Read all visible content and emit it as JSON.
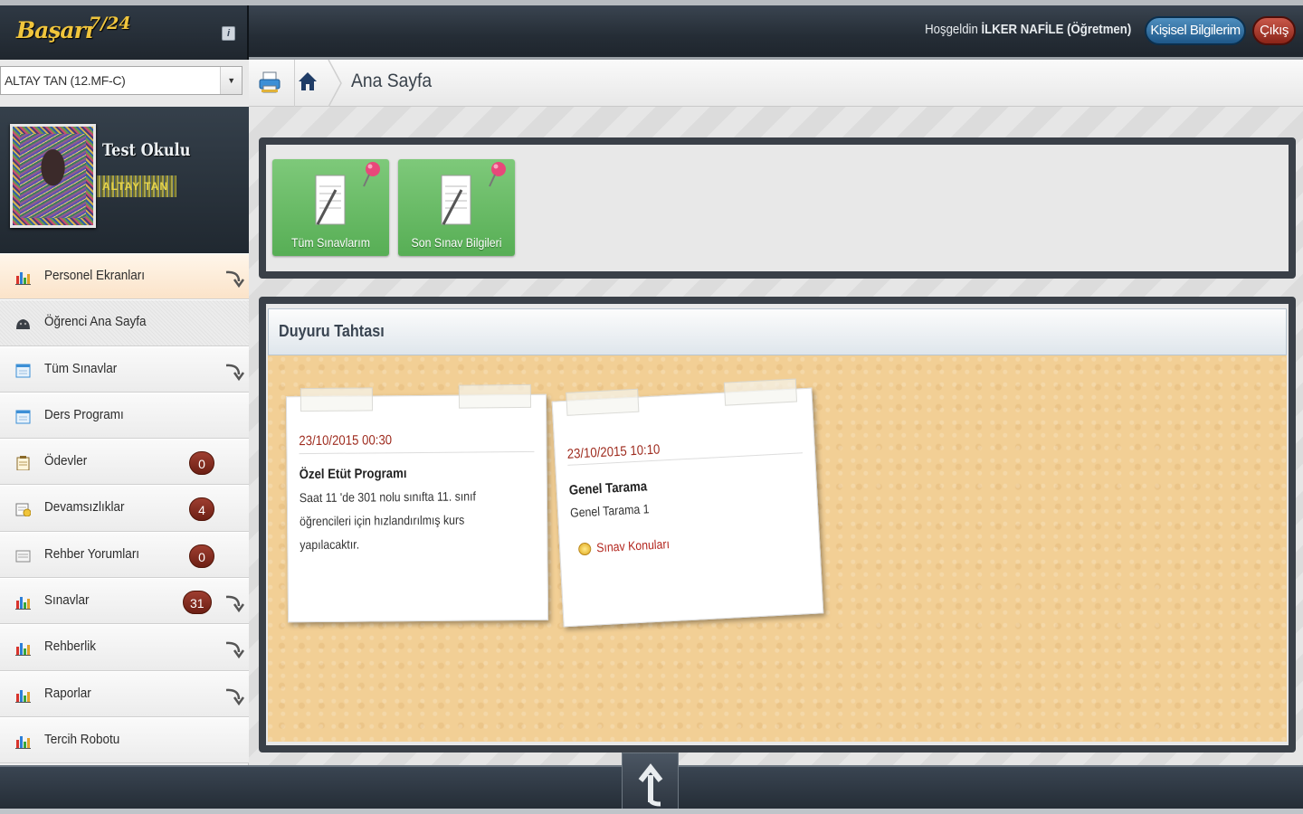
{
  "header": {
    "logo_text": "Başarı",
    "logo_sup": "7/24",
    "info_icon": "i",
    "welcome_prefix": "Hoşgeldin",
    "welcome_user": "İLKER NAFİLE (Öğretmen)",
    "profile_button": "Kişisel Bilgilerim",
    "exit_button": "Çıkış"
  },
  "student_select": {
    "value": "ALTAY TAN (12.MF-C)"
  },
  "breadcrumb": {
    "title": "Ana Sayfa"
  },
  "profile": {
    "school": "Test Okulu",
    "student_name": "ALTAY TAN"
  },
  "sidebar": {
    "items": [
      {
        "label": "Personel Ekranları",
        "icon": "bar-chart-icon",
        "arrow": true
      },
      {
        "label": "Öğrenci Ana Sayfa",
        "icon": "student-icon",
        "arrow": false
      },
      {
        "label": "Tüm Sınavlar",
        "icon": "calendar-icon",
        "arrow": true
      },
      {
        "label": "Ders Programı",
        "icon": "calendar-icon",
        "arrow": false
      },
      {
        "label": "Ödevler",
        "icon": "clipboard-icon",
        "badge": "0",
        "arrow": false
      },
      {
        "label": "Devamsızlıklar",
        "icon": "attendance-icon",
        "badge": "4",
        "arrow": false
      },
      {
        "label": "Rehber Yorumları",
        "icon": "comment-icon",
        "badge": "0",
        "arrow": false
      },
      {
        "label": "Sınavlar",
        "icon": "bar-chart-icon",
        "badge": "31",
        "arrow": true
      },
      {
        "label": "Rehberlik",
        "icon": "bar-chart-icon",
        "arrow": true
      },
      {
        "label": "Raporlar",
        "icon": "bar-chart-icon",
        "arrow": true
      },
      {
        "label": "Tercih Robotu",
        "icon": "bar-chart-icon",
        "arrow": false
      }
    ]
  },
  "tiles": [
    {
      "label": "Tüm Sınavlarım"
    },
    {
      "label": "Son Sınav Bilgileri"
    }
  ],
  "board": {
    "title": "Duyuru Tahtası",
    "notes": [
      {
        "date": "23/10/2015 00:30",
        "title": "Özel Etüt Programı",
        "body_lines": [
          "Saat 11 'de 301 nolu sınıfta 11. sınıf",
          "öğrencileri için hızlandırılmış kurs",
          "yapılacaktır."
        ]
      },
      {
        "date": "23/10/2015 10:10",
        "title": "Genel Tarama",
        "body_lines": [
          "Genel Tarama 1"
        ],
        "link": "Sınav Konuları"
      }
    ]
  },
  "colors": {
    "accent_gold": "#f0c53c",
    "tile_green": "#6abd66",
    "badge_red": "#8a2c1f",
    "date_red": "#9e2b1e"
  }
}
